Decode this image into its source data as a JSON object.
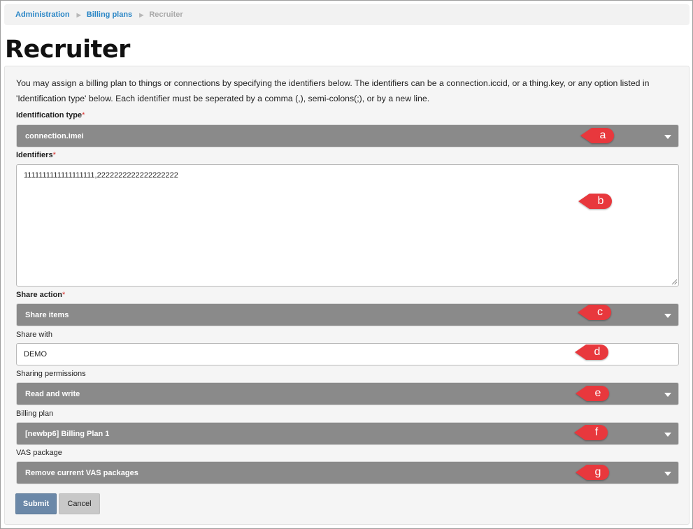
{
  "breadcrumb": {
    "items": [
      {
        "label": "Administration"
      },
      {
        "label": "Billing plans"
      },
      {
        "label": "Recruiter"
      }
    ]
  },
  "page": {
    "title": "Recruiter"
  },
  "form": {
    "intro": "You may assign a billing plan to things or connections by specifying the identifiers below. The identifiers can be a connection.iccid, or a thing.key, or any option listed in 'Identification type' below. Each identifier must be seperated by a comma (,), semi-colons(;), or by a new line.",
    "required_marker": "*",
    "identification_type": {
      "label": "Identification type",
      "value": "connection.imei"
    },
    "identifiers": {
      "label": "Identifiers",
      "value": "1111111111111111111,2222222222222222222"
    },
    "share_action": {
      "label": "Share action",
      "value": "Share items"
    },
    "share_with": {
      "label": "Share with",
      "value": "DEMO"
    },
    "sharing_permissions": {
      "label": "Sharing permissions",
      "value": "Read and write"
    },
    "billing_plan": {
      "label": "Billing plan",
      "value": "[newbp6] Billing Plan 1"
    },
    "vas_package": {
      "label": "VAS package",
      "value": "Remove current VAS packages"
    },
    "submit_label": "Submit",
    "cancel_label": "Cancel"
  },
  "callouts": [
    "a",
    "b",
    "c",
    "d",
    "e",
    "f",
    "g"
  ],
  "colors": {
    "link": "#2a86c6",
    "select_bg": "#8a8a8a",
    "callout": "#e8383d",
    "submit_bg": "#6b88a8",
    "required": "#d9302c"
  },
  "icons": {
    "breadcrumb_separator": "triangle-right-icon",
    "select_caret": "caret-down-icon"
  }
}
